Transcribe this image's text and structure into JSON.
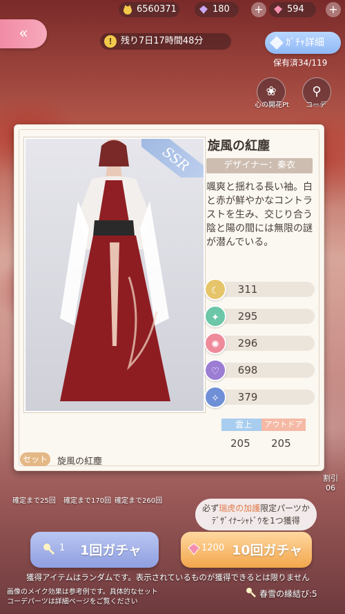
{
  "currencies": {
    "coins": "6560371",
    "diamonds": "180",
    "crystals": "594"
  },
  "back_label": "«",
  "timer": {
    "icon": "!",
    "text": "残り7日17時間48分"
  },
  "gacha_detail_label": "ｶﾞﾁｬ詳細",
  "owned": "保有済34/119",
  "right_buttons": [
    {
      "icon": "❀",
      "label": "心の開花Pt"
    },
    {
      "icon": "⚲",
      "label": "コーデ"
    }
  ],
  "item": {
    "rarity": "SSR",
    "name": "旋風の紅塵",
    "designer": "デザイナー：秦衣",
    "description": "颯爽と揺れる長い袖。白と赤が鮮やかなコントラストを生み、交じり合う陰と陽の間には無限の謎が潜んでいる。",
    "stats": [
      {
        "icon": "☾",
        "value": "311",
        "color": "#e6c46a"
      },
      {
        "icon": "✦",
        "value": "295",
        "color": "#6cc6a8"
      },
      {
        "icon": "✺",
        "value": "296",
        "color": "#ee8a9a"
      },
      {
        "icon": "♡",
        "value": "698",
        "color": "#9b7dd4"
      },
      {
        "icon": "✧",
        "value": "379",
        "color": "#6f8fd6"
      }
    ],
    "tags": [
      {
        "label": "雲上",
        "value": "205"
      },
      {
        "label": "アウトドア",
        "value": "205"
      }
    ],
    "set_label": "セット",
    "set_name": "旋風の紅塵"
  },
  "guarantees": [
    "確定まで25回",
    "確定まで170回",
    "確定まで260回"
  ],
  "promo": {
    "prefix": "必ず",
    "highlight": "瑞虎の加護",
    "suffix": "限定パーツか",
    "line2": "ﾃﾞｻﾞｲﾅｰｼｬﾄﾞｳを1つ獲得"
  },
  "pull1": {
    "cost": "1",
    "label": "1回ガチャ"
  },
  "pull10": {
    "cost": "1200",
    "label": "10回ガチャ"
  },
  "notes": {
    "random": "獲得アイテムはランダムです。表示されているものが獲得できるとは限りません",
    "makeup1": "画像のメイク効果は参考例です。具体的なセット",
    "makeup2": "コーデパーツは詳細ページをご覧ください",
    "ticket": "春雪の縁結び:5"
  },
  "side_fragments": {
    "discount": "割引",
    "discount_value": "06"
  }
}
